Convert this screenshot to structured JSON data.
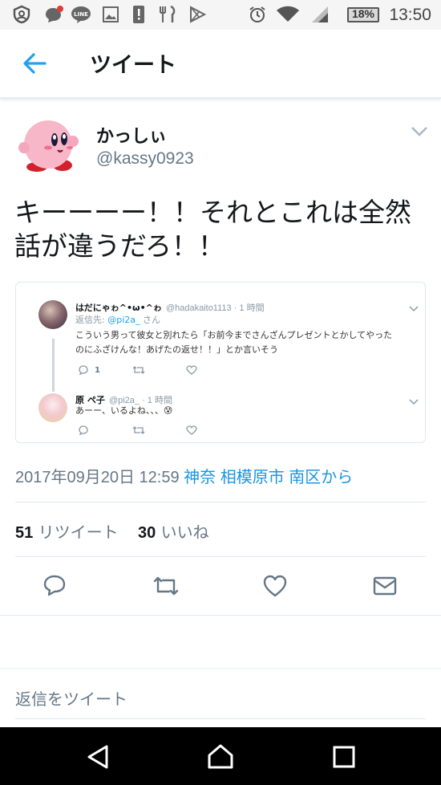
{
  "status_bar": {
    "time": "13:50",
    "battery": "18%",
    "icons": [
      "shield-icon",
      "notification-app-icon",
      "line-icon",
      "gallery-icon",
      "alert-icon",
      "restaurant-icon",
      "play-store-icon",
      "alarm-icon",
      "wifi-icon",
      "signal-icon",
      "battery-icon"
    ]
  },
  "header": {
    "title": "ツイート"
  },
  "tweet": {
    "display_name": "かっしぃ",
    "handle": "@kassy0923",
    "text": "キーーーー！！それとこれは全然話が違うだろ！！",
    "timestamp": "2017年09月20日 12:59",
    "location": "神奈 相模原市 南区から",
    "retweet_count": "51",
    "retweet_label": "リツイート",
    "like_count": "30",
    "like_label": "いいね"
  },
  "embedded": {
    "tweet1": {
      "name": "はだにゃゎ^•ω•^ゎ",
      "handle_time": "@hadakaito1113 · 1 時間",
      "reply_prefix": "返信先:",
      "reply_handle": "@pi2a_",
      "reply_suffix": "さん",
      "line1": "こういう男って彼女と別れたら「お前今までさんざんプレゼントとかしてやった",
      "line2": "のにふざけんな！あげたの返せ！！」とか言いそう",
      "reply_count": "1"
    },
    "tweet2": {
      "name": "原 ペ子",
      "handle_time": "@pi2a_ · 1 時間",
      "text": "あーー、いるよね、、、😰"
    }
  },
  "reply_placeholder": "返信をツイート",
  "colors": {
    "accent": "#1da1f2",
    "text": "#14171a",
    "secondary": "#657786"
  }
}
